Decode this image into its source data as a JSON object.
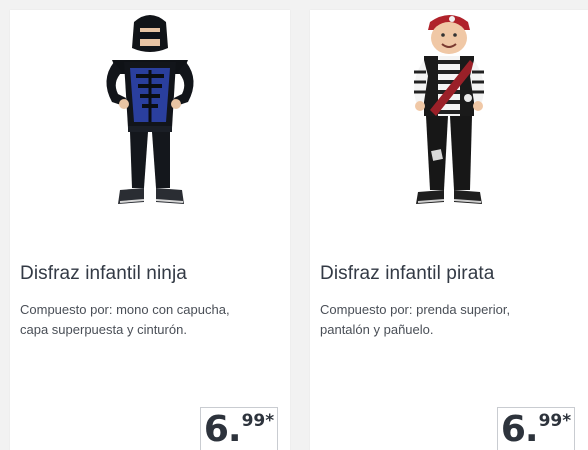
{
  "products": [
    {
      "title": "Disfraz infantil ninja",
      "description": "Compuesto por: mono con capucha, capa superpuesta y cinturón.",
      "price_int": "6.",
      "price_dec": "99*",
      "image_icon": "ninja-costume-child-photo"
    },
    {
      "title": "Disfraz infantil pirata",
      "description": "Compuesto por: prenda superior, pantalón y pañuelo.",
      "price_int": "6.",
      "price_dec": "99*",
      "image_icon": "pirate-costume-child-photo"
    }
  ],
  "colors": {
    "background": "#f2f2f2",
    "card": "#ffffff",
    "title_text": "#333a45",
    "price_border": "#c9ccd1"
  }
}
